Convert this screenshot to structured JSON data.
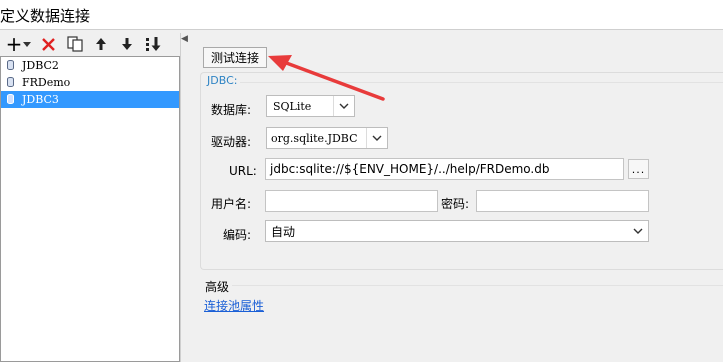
{
  "window": {
    "title": "定义数据连接"
  },
  "toolbar": {
    "add_label": "+",
    "colors": {
      "delete": "#e02020"
    },
    "icons": [
      "add-icon",
      "dropdown-arrow-icon",
      "delete-icon",
      "copy-icon",
      "move-up-icon",
      "move-down-icon",
      "sort-icon"
    ]
  },
  "connections": [
    {
      "name": "JDBC2",
      "selected": false
    },
    {
      "name": "FRDemo",
      "selected": false
    },
    {
      "name": "JDBC3",
      "selected": true
    }
  ],
  "test_button": {
    "label": "测试连接"
  },
  "jdbc": {
    "group_label": "JDBC:",
    "database_label": "数据库:",
    "database_value": "SQLite",
    "driver_label": "驱动器:",
    "driver_value": "org.sqlite.JDBC",
    "url_label": "URL:",
    "url_value": "jdbc:sqlite://${ENV_HOME}/../help/FRDemo.db",
    "browse_label": "...",
    "username_label": "用户名:",
    "username_value": "",
    "password_label": "密码:",
    "password_value": "",
    "encoding_label": "编码:",
    "encoding_value": "自动"
  },
  "advanced": {
    "label": "高级",
    "pool_link": "连接池属性"
  },
  "annotation": {
    "color": "#e83b3b",
    "points_to": "test-connection-button"
  },
  "colors": {
    "selection": "#3399ff",
    "link": "#1a5fd6",
    "group_label": "#2f84c4"
  }
}
